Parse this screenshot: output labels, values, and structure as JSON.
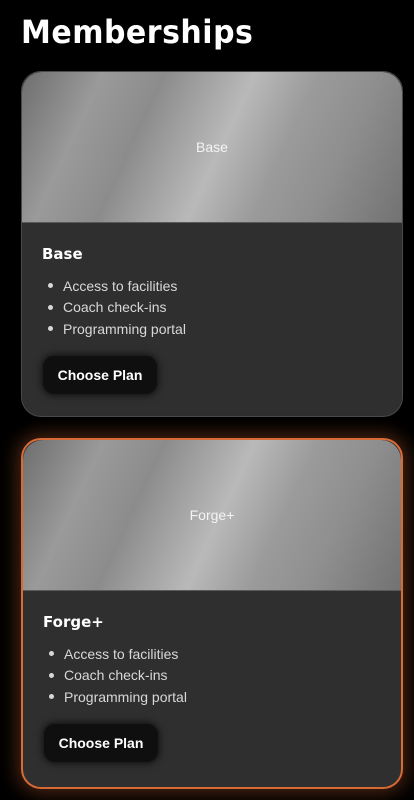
{
  "page": {
    "title": "Memberships"
  },
  "plans": [
    {
      "image_label": "Base",
      "name": "Base",
      "features": [
        "Access to facilities",
        "Coach check-ins",
        "Programming portal"
      ],
      "button_label": "Choose Plan",
      "featured": false
    },
    {
      "image_label": "Forge+",
      "name": "Forge+",
      "features": [
        "Access to facilities",
        "Coach check-ins",
        "Programming portal"
      ],
      "button_label": "Choose Plan",
      "featured": true
    }
  ],
  "colors": {
    "background": "#000000",
    "card": "#2f2f2f",
    "accent": "#d86a35",
    "button": "#0f0f0f"
  }
}
